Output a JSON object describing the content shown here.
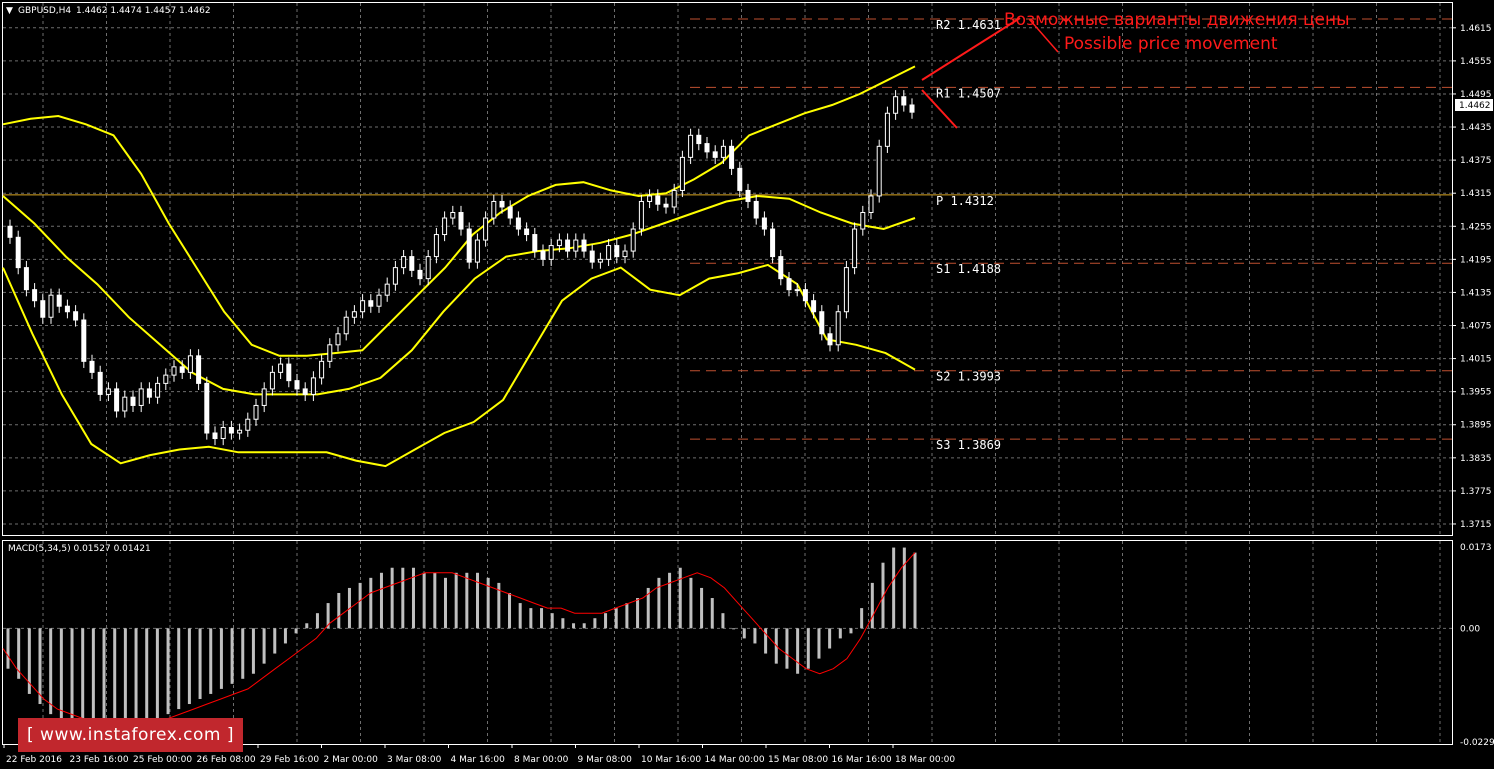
{
  "header": {
    "symbol_label": "GBPUSD,H4",
    "quote": "1.4462 1.4474 1.4457 1.4462",
    "macd_label": "MACD(5,34,5) 0.01527 0.01421"
  },
  "annotations": {
    "ru": "Возможные варианты движения цены",
    "en": "Possible price movement"
  },
  "watermark": "[ www.instaforex.com ]",
  "colors": {
    "bollinger": "#ffff00",
    "tenkan": "#d40000",
    "kijun": "#1a1aff",
    "chikou": "#22c022",
    "pivot": "#d9a520",
    "levels": "#c05030",
    "macd_hist": "#c0c0c0",
    "macd_signal": "#ff0000",
    "up_candle": "#ffffff",
    "down_candle": "#ffffff"
  },
  "chart_data": [
    {
      "type": "candlestick",
      "symbol": "GBPUSD",
      "timeframe": "H4",
      "ylim": [
        1.3695,
        1.466
      ],
      "yticks": [
        "1.4615",
        "1.4555",
        "1.4495",
        "1.4435",
        "1.4375",
        "1.4315",
        "1.4255",
        "1.4195",
        "1.4135",
        "1.4075",
        "1.4015",
        "1.3955",
        "1.3895",
        "1.3835",
        "1.3775",
        "1.3715"
      ],
      "current_price": "1.4462",
      "xticks": [
        "22 Feb 2016",
        "23 Feb 16:00",
        "25 Feb 00:00",
        "26 Feb 08:00",
        "29 Feb 16:00",
        "2 Mar 00:00",
        "3 Mar 08:00",
        "4 Mar 16:00",
        "8 Mar 00:00",
        "9 Mar 08:00",
        "10 Mar 16:00",
        "14 Mar 00:00",
        "15 Mar 08:00",
        "16 Mar 16:00",
        "18 Mar 00:00"
      ],
      "closes": [
        1.4235,
        1.418,
        1.414,
        1.412,
        1.409,
        1.413,
        1.411,
        1.41,
        1.4085,
        1.401,
        1.399,
        1.395,
        1.396,
        1.392,
        1.3945,
        1.393,
        1.396,
        1.3945,
        1.397,
        1.3985,
        1.4,
        1.399,
        1.402,
        1.397,
        1.388,
        1.387,
        1.389,
        1.388,
        1.3885,
        1.3905,
        1.393,
        1.396,
        1.399,
        1.4005,
        1.3975,
        1.396,
        1.395,
        1.398,
        1.401,
        1.404,
        1.406,
        1.409,
        1.41,
        1.412,
        1.411,
        1.413,
        1.415,
        1.418,
        1.42,
        1.4175,
        1.416,
        1.42,
        1.424,
        1.427,
        1.428,
        1.425,
        1.419,
        1.423,
        1.427,
        1.43,
        1.429,
        1.427,
        1.425,
        1.424,
        1.421,
        1.4195,
        1.422,
        1.423,
        1.421,
        1.423,
        1.421,
        1.419,
        1.4195,
        1.422,
        1.42,
        1.421,
        1.425,
        1.43,
        1.431,
        1.4295,
        1.429,
        1.432,
        1.438,
        1.442,
        1.4405,
        1.439,
        1.438,
        1.44,
        1.436,
        1.432,
        1.43,
        1.427,
        1.425,
        1.42,
        1.416,
        1.414,
        1.414,
        1.412,
        1.41,
        1.406,
        1.404,
        1.41,
        1.418,
        1.425,
        1.428,
        1.431,
        1.44,
        1.446,
        1.449,
        1.4475,
        1.4462
      ],
      "series": [
        {
          "name": "Bollinger upper",
          "values": [
            1.444,
            1.445,
            1.4455,
            1.444,
            1.442,
            1.435,
            1.426,
            1.418,
            1.41,
            1.404,
            1.402,
            1.402,
            1.4025,
            1.403,
            1.408,
            1.413,
            1.418,
            1.424,
            1.428,
            1.431,
            1.433,
            1.4335,
            1.432,
            1.431,
            1.4315,
            1.434,
            1.437,
            1.442,
            1.444,
            1.446,
            1.4475,
            1.4495,
            1.452,
            1.4545
          ]
        },
        {
          "name": "Bollinger middle",
          "values": [
            1.431,
            1.426,
            1.42,
            1.415,
            1.409,
            1.404,
            1.399,
            1.396,
            1.395,
            1.395,
            1.395,
            1.396,
            1.398,
            1.403,
            1.41,
            1.416,
            1.42,
            1.421,
            1.4215,
            1.4225,
            1.424,
            1.426,
            1.428,
            1.43,
            1.431,
            1.4305,
            1.428,
            1.426,
            1.425,
            1.427
          ]
        },
        {
          "name": "Bollinger lower",
          "values": [
            1.418,
            1.406,
            1.395,
            1.386,
            1.3825,
            1.384,
            1.385,
            1.3855,
            1.3845,
            1.3845,
            1.3845,
            1.3845,
            1.383,
            1.382,
            1.385,
            1.388,
            1.39,
            1.394,
            1.403,
            1.412,
            1.416,
            1.418,
            1.414,
            1.413,
            1.416,
            1.417,
            1.4185,
            1.415,
            1.405,
            1.404,
            1.4025,
            1.3995
          ]
        }
      ],
      "levels": [
        {
          "name": "R2",
          "label": "R2  1.4631",
          "value": 1.4631
        },
        {
          "name": "R1",
          "label": "R1  1.4507",
          "value": 1.4507
        },
        {
          "name": "P",
          "label": "P  1.4312",
          "value": 1.4312
        },
        {
          "name": "S1",
          "label": "S1  1.4188",
          "value": 1.4188
        },
        {
          "name": "S2",
          "label": "S2  1.3993",
          "value": 1.3993
        },
        {
          "name": "S3",
          "label": "S3  1.3869",
          "value": 1.3869
        }
      ]
    },
    {
      "type": "bar",
      "indicator": "MACD",
      "ylim": [
        -0.02292,
        0.0173
      ],
      "yticks": [
        "0.0173",
        "0.00",
        "-0.02292"
      ],
      "values": [
        -0.008,
        -0.01,
        -0.013,
        -0.015,
        -0.017,
        -0.018,
        -0.019,
        -0.019,
        -0.02,
        -0.021,
        -0.021,
        -0.02,
        -0.019,
        -0.019,
        -0.018,
        -0.017,
        -0.016,
        -0.015,
        -0.014,
        -0.013,
        -0.012,
        -0.011,
        -0.01,
        -0.009,
        -0.007,
        -0.005,
        -0.003,
        -0.001,
        0.001,
        0.003,
        0.005,
        0.007,
        0.008,
        0.009,
        0.01,
        0.011,
        0.012,
        0.012,
        0.012,
        0.011,
        0.011,
        0.01,
        0.011,
        0.011,
        0.011,
        0.01,
        0.009,
        0.007,
        0.005,
        0.004,
        0.004,
        0.003,
        0.002,
        0.001,
        0.001,
        0.002,
        0.003,
        0.004,
        0.005,
        0.006,
        0.008,
        0.01,
        0.011,
        0.012,
        0.01,
        0.008,
        0.006,
        0.003,
        0.0,
        -0.002,
        -0.003,
        -0.005,
        -0.007,
        -0.008,
        -0.009,
        -0.008,
        -0.006,
        -0.004,
        -0.002,
        -0.001,
        0.004,
        0.009,
        0.013,
        0.016,
        0.016,
        0.015
      ],
      "signal": [
        -0.004,
        -0.008,
        -0.011,
        -0.014,
        -0.016,
        -0.017,
        -0.018,
        -0.019,
        -0.019,
        -0.02,
        -0.02,
        -0.019,
        -0.018,
        -0.017,
        -0.016,
        -0.015,
        -0.014,
        -0.013,
        -0.012,
        -0.01,
        -0.008,
        -0.006,
        -0.004,
        -0.002,
        0.001,
        0.003,
        0.005,
        0.007,
        0.008,
        0.009,
        0.01,
        0.011,
        0.011,
        0.011,
        0.01,
        0.009,
        0.008,
        0.007,
        0.006,
        0.005,
        0.004,
        0.004,
        0.003,
        0.003,
        0.003,
        0.004,
        0.005,
        0.006,
        0.008,
        0.009,
        0.01,
        0.011,
        0.01,
        0.008,
        0.005,
        0.002,
        -0.001,
        -0.004,
        -0.006,
        -0.008,
        -0.009,
        -0.008,
        -0.006,
        -0.002,
        0.003,
        0.008,
        0.012,
        0.015
      ]
    }
  ]
}
